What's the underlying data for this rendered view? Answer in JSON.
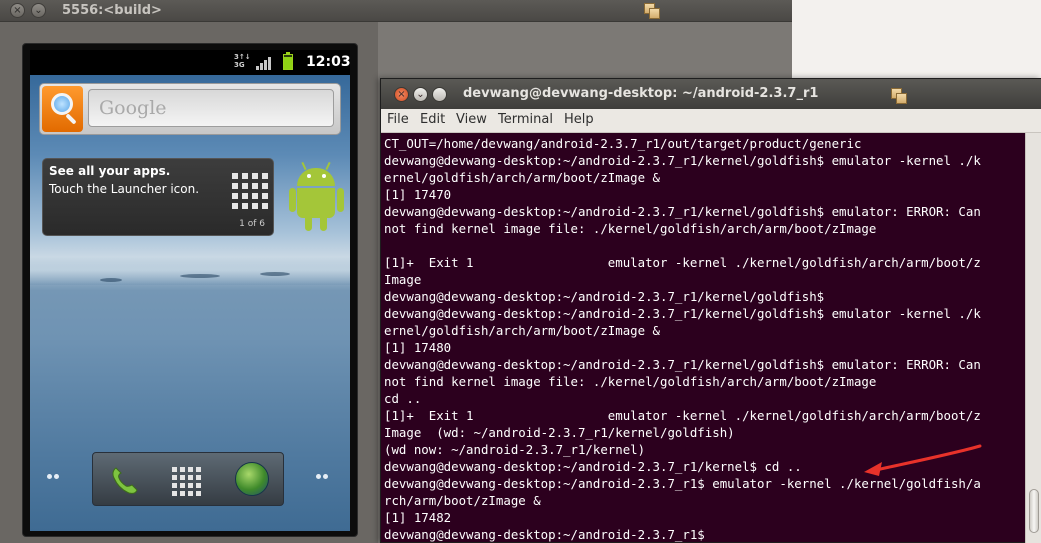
{
  "emulator_window": {
    "title": "5556:<build>",
    "close_glyph": "×",
    "minimize_glyph": "⌄"
  },
  "phone": {
    "status_bar": {
      "network_type": "3G",
      "signal_label": "3↑↓",
      "time": "12:03"
    },
    "search_widget": {
      "placeholder": "Google"
    },
    "launcher_tip": {
      "title": "See all your apps.",
      "subtitle": "Touch the Launcher icon.",
      "page_indicator": "1 of 6"
    },
    "dock": {
      "items": [
        "phone-icon",
        "app-drawer-icon",
        "browser-globe-icon"
      ]
    }
  },
  "terminal_window": {
    "title": "devwang@devwang-desktop: ~/android-2.3.7_r1",
    "menu": [
      "File",
      "Edit",
      "View",
      "Terminal",
      "Help"
    ],
    "lines": [
      "CT_OUT=/home/devwang/android-2.3.7_r1/out/target/product/generic",
      "devwang@devwang-desktop:~/android-2.3.7_r1/kernel/goldfish$ emulator -kernel ./k",
      "ernel/goldfish/arch/arm/boot/zImage &",
      "[1] 17470",
      "devwang@devwang-desktop:~/android-2.3.7_r1/kernel/goldfish$ emulator: ERROR: Can",
      "not find kernel image file: ./kernel/goldfish/arch/arm/boot/zImage",
      "",
      "[1]+  Exit 1                  emulator -kernel ./kernel/goldfish/arch/arm/boot/z",
      "Image",
      "devwang@devwang-desktop:~/android-2.3.7_r1/kernel/goldfish$",
      "devwang@devwang-desktop:~/android-2.3.7_r1/kernel/goldfish$ emulator -kernel ./k",
      "ernel/goldfish/arch/arm/boot/zImage &",
      "[1] 17480",
      "devwang@devwang-desktop:~/android-2.3.7_r1/kernel/goldfish$ emulator: ERROR: Can",
      "not find kernel image file: ./kernel/goldfish/arch/arm/boot/zImage",
      "cd ..",
      "[1]+  Exit 1                  emulator -kernel ./kernel/goldfish/arch/arm/boot/z",
      "Image  (wd: ~/android-2.3.7_r1/kernel/goldfish)",
      "(wd now: ~/android-2.3.7_r1/kernel)",
      "devwang@devwang-desktop:~/android-2.3.7_r1/kernel$ cd ..",
      "devwang@devwang-desktop:~/android-2.3.7_r1$ emulator -kernel ./kernel/goldfish/a",
      "rch/arm/boot/zImage &",
      "[1] 17482",
      "devwang@devwang-desktop:~/android-2.3.7_r1$"
    ]
  },
  "colors": {
    "terminal_bg": "#2c001e",
    "terminal_fg": "#ffffff",
    "annotation_arrow": "#e8322a",
    "android_green": "#a4c639",
    "search_orange": "#f08412"
  }
}
